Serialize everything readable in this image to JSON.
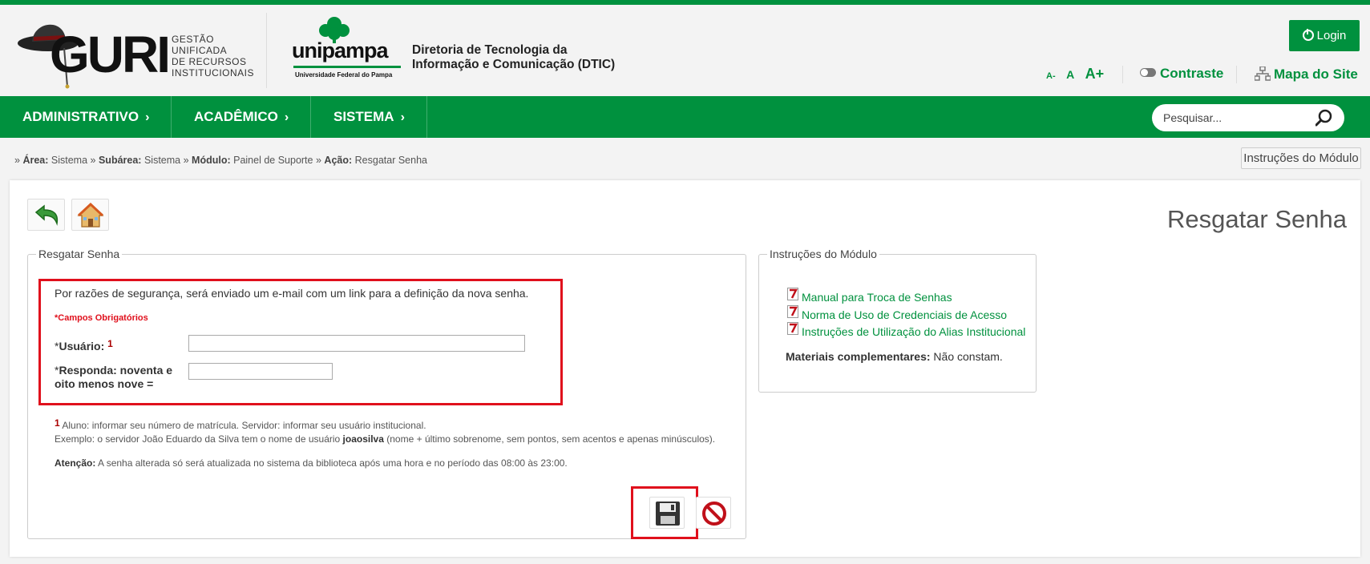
{
  "header": {
    "guri": {
      "name": "GURI",
      "subtitle": [
        "GESTÃO",
        "UNIFICADA",
        "DE RECURSOS",
        "INSTITUCIONAIS"
      ]
    },
    "unipampa": {
      "name": "unipampa",
      "subtitle": "Universidade Federal do Pampa"
    },
    "dtic": [
      "Diretoria de Tecnologia da",
      "Informação e Comunicação (DTIC)"
    ],
    "login_label": "Login",
    "font_small": "A-",
    "font_normal": "A",
    "font_large": "A+",
    "contrast_label": "Contraste",
    "sitemap_label": "Mapa do Site"
  },
  "nav": {
    "items": [
      {
        "label": "ADMINISTRATIVO",
        "chevron": "›"
      },
      {
        "label": "ACADÊMICO",
        "chevron": "›"
      },
      {
        "label": "SISTEMA",
        "chevron": "›"
      }
    ],
    "search_placeholder": "Pesquisar..."
  },
  "breadcrumb": {
    "sep": "»",
    "items": [
      {
        "key": "Área:",
        "value": "Sistema"
      },
      {
        "key": "Subárea:",
        "value": "Sistema"
      },
      {
        "key": "Módulo:",
        "value": "Painel de Suporte"
      },
      {
        "key": "Ação:",
        "value": "Resgatar Senha"
      }
    ],
    "instructions_button": "Instruções do Módulo"
  },
  "page": {
    "title": "Resgatar Senha"
  },
  "form": {
    "legend": "Resgatar Senha",
    "intro": "Por razões de segurança, será enviado um e-mail com um link para a definição da nova senha.",
    "required_note": "*Campos Obrigatórios",
    "usuario": {
      "asterisk": "*",
      "label": "Usuário:",
      "footnote": "1",
      "value": ""
    },
    "captcha": {
      "asterisk": "*",
      "label_line1": "Responda: noventa e",
      "label_line2": "oito menos nove =",
      "value": ""
    },
    "footnote_marker": "1",
    "footnote_line1": "Aluno: informar seu número de matrícula. Servidor: informar seu usuário institucional.",
    "example_prefix": "Exemplo: o servidor João Eduardo da Silva tem o nome de usuário",
    "example_user": "joaosilva",
    "example_suffix": "(nome + último sobrenome, sem pontos, sem acentos e apenas minúsculos).",
    "attention_label": "Atenção:",
    "attention_text": "A senha alterada só será atualizada no sistema da biblioteca após uma hora e no período das 08:00 às 23:00."
  },
  "instructions": {
    "legend": "Instruções do Módulo",
    "links": [
      "Manual para Troca de Senhas",
      "Norma de Uso de Credenciais de Acesso",
      "Instruções de Utilização do Alias Institucional"
    ],
    "materials_label": "Materiais complementares:",
    "materials_value": "Não constam."
  },
  "icons": {
    "back": "back-arrow-icon",
    "home": "home-icon",
    "save": "floppy-disk-icon",
    "cancel": "cancel-icon",
    "pdf": "pdf-icon",
    "search": "magnifier-icon",
    "login": "power-icon",
    "contrast": "toggle-icon",
    "sitemap": "sitemap-icon"
  },
  "colors": {
    "brand_green": "#00913e",
    "highlight_red": "#e0101c"
  }
}
